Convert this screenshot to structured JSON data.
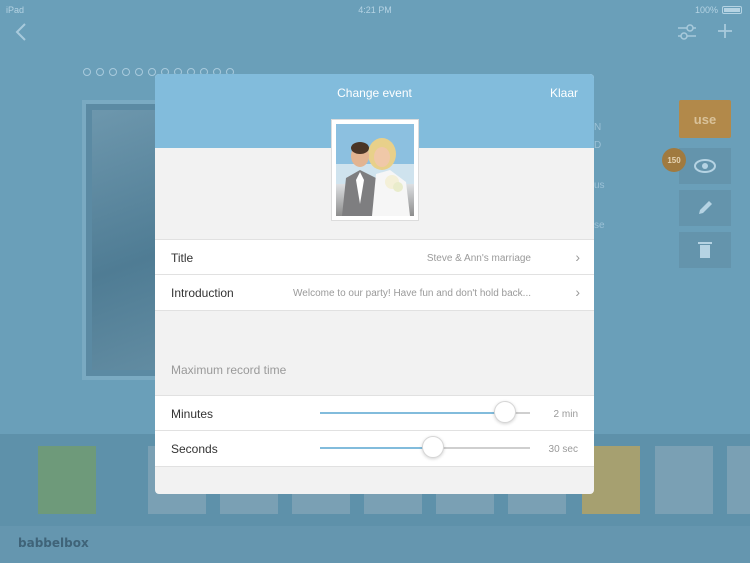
{
  "status_bar": {
    "device": "iPad",
    "time": "4:21 PM",
    "battery": "100%"
  },
  "background": {
    "side_text": [
      "N",
      "D",
      "us",
      "se"
    ],
    "use_label": "use",
    "badge_count": "150",
    "brand": "babbelbox"
  },
  "modal": {
    "title": "Change event",
    "done_label": "Klaar",
    "fields": [
      {
        "label": "Title",
        "value": "Steve & Ann's marriage"
      },
      {
        "label": "Introduction",
        "value": "Welcome to our party! Have fun and don't hold back..."
      }
    ],
    "section_label": "Maximum record time",
    "sliders": [
      {
        "label": "Minutes",
        "value_text": "2 min",
        "fraction": 0.88
      },
      {
        "label": "Seconds",
        "value_text": "30 sec",
        "fraction": 0.54
      }
    ]
  },
  "colors": {
    "header": "#82bcdc",
    "overlay": "#6a9fb9",
    "use_button": "#b2894a"
  }
}
